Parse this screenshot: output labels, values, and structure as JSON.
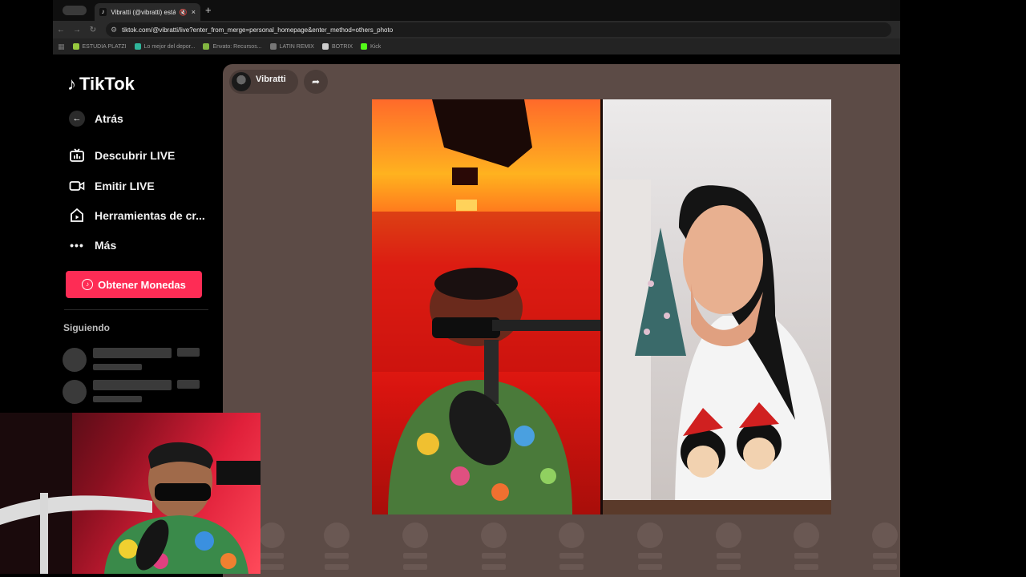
{
  "browser": {
    "tab_title": "Vibratti (@vibratti) está LIVE",
    "tab_close": "×",
    "new_tab": "+",
    "url": "tiktok.com/@vibratti/live?enter_from_merge=personal_homepage&enter_method=others_photo",
    "bookmarks": [
      {
        "label": "ESTUDIA PLATZI",
        "color": "#98ca3f"
      },
      {
        "label": "Lo mejor del depor...",
        "color": "#2fb59a"
      },
      {
        "label": "Envato: Recursos...",
        "color": "#82b541"
      },
      {
        "label": "LATIN REMIX",
        "color": "#777777"
      },
      {
        "label": "BOTRIX",
        "color": "#cccccc"
      },
      {
        "label": "Kick",
        "color": "#53fc18"
      }
    ]
  },
  "sidebar": {
    "logo_text": "TikTok",
    "back_label": "Atrás",
    "items": [
      {
        "label": "Descubrir LIVE",
        "icon": "live-tv-icon"
      },
      {
        "label": "Emitir LIVE",
        "icon": "video-camera-icon"
      },
      {
        "label": "Herramientas de cr...",
        "icon": "creator-tools-icon"
      },
      {
        "label": "Más",
        "icon": "more-dots-icon"
      }
    ],
    "coins_button": "Obtener Monedas",
    "following_title": "Siguiendo"
  },
  "live": {
    "host_name": "Vibratti"
  },
  "colors": {
    "brand_accent": "#fe2c55",
    "live_background": "#5c4b46"
  }
}
